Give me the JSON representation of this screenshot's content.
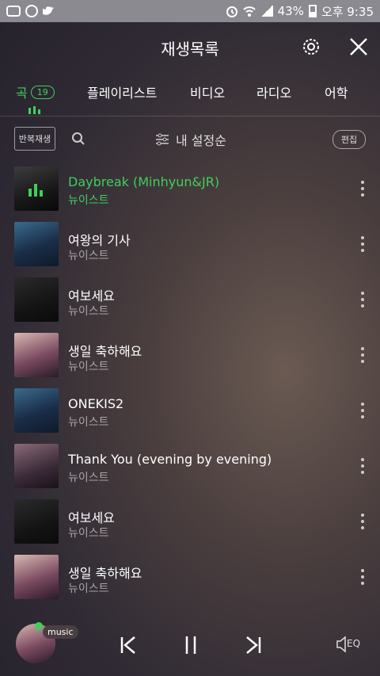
{
  "status_bar": {
    "battery": "43%",
    "time": "오후 9:35"
  },
  "header": {
    "title": "재생목록"
  },
  "tabs": [
    {
      "label": "곡",
      "badge": "19",
      "active": true
    },
    {
      "label": "플레이리스트"
    },
    {
      "label": "비디오"
    },
    {
      "label": "라디오"
    },
    {
      "label": "어학"
    }
  ],
  "toolbar": {
    "repeat_label": "반복재생",
    "sort_label": "내 설정순",
    "edit_label": "편집"
  },
  "songs": [
    {
      "title": "Daybreak (Minhyun&JR)",
      "artist": "뉴이스트",
      "art": "a",
      "playing": true
    },
    {
      "title": "여왕의 기사",
      "artist": "뉴이스트",
      "art": "b"
    },
    {
      "title": "여보세요",
      "artist": "뉴이스트",
      "art": "c"
    },
    {
      "title": "생일 축하해요",
      "artist": "뉴이스트",
      "art": "d"
    },
    {
      "title": "ONEKIS2",
      "artist": "뉴이스트",
      "art": "b"
    },
    {
      "title": "Thank You (evening by evening)",
      "artist": "뉴이스트",
      "art": "e"
    },
    {
      "title": "여보세요",
      "artist": "뉴이스트",
      "art": "c"
    },
    {
      "title": "생일 축하해요",
      "artist": "뉴이스트",
      "art": "d"
    }
  ],
  "player": {
    "badge": "music",
    "eq_label": "EQ"
  },
  "colors": {
    "accent": "#3fd05a"
  }
}
